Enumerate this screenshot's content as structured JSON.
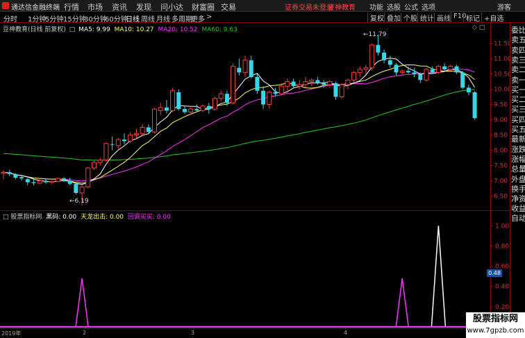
{
  "app": {
    "title": "通达信金融终端",
    "menu": [
      "行情",
      "市场",
      "资讯",
      "发现",
      "问小达",
      "财富圈",
      "交易"
    ],
    "notice": "证券交易未登录",
    "brand": "豆神教育",
    "right_menu": [
      "功能",
      "选股",
      "公式",
      "选项"
    ],
    "guest": "游客"
  },
  "toolbar": {
    "periods": [
      "分时",
      "1分钟",
      "5分钟",
      "15分钟",
      "30分钟",
      "60分钟",
      "日线",
      "周线",
      "月线",
      "多周期",
      "更多"
    ],
    "active": "日线",
    "more_arrow": ">",
    "right_items": [
      "复权",
      "叠加",
      "个股",
      "统计",
      "画线",
      "F10",
      "标记",
      "+自选"
    ]
  },
  "chart": {
    "title": "豆神教育(日线 前复权)",
    "ma5": "MA5: 9.99",
    "ma10": "MA10: 10.27",
    "ma20": "MA20: 10.52",
    "ma60": "MA60: 9.63",
    "high_label": "11.79",
    "low_label": "6.19",
    "price_ticks": [
      "11.50",
      "11.00",
      "10.50",
      "10.00",
      "9.50",
      "9.00",
      "8.50",
      "8.00",
      "7.50",
      "7.00",
      "6.50"
    ]
  },
  "indicator": {
    "name": "股票指标网",
    "l1": "黑码: 0.00",
    "l2": "天龙出击: 0.00",
    "l3": "回调买买: 0.00",
    "ticks": [
      "1.00",
      "0.80",
      "0.60",
      "0.40",
      "0.20"
    ],
    "current": "0.48"
  },
  "timeline": {
    "labels": [
      "2019年",
      "2",
      "3",
      "4"
    ]
  },
  "sidebar": {
    "items": [
      "委比",
      "卖五",
      "卖四",
      "卖三",
      "卖二",
      "卖一",
      "买一",
      "买二",
      "买三",
      "买四",
      "买五",
      "最新",
      "涨跌",
      "涨幅",
      "总量",
      "外盘",
      "换手",
      "净资",
      "收益"
    ],
    "auto": "自动"
  },
  "watermark": {
    "line1": "股票指标网",
    "line2": "www.7gpzb.com"
  },
  "colors": {
    "up": "#ff3b3b",
    "down": "#37d7e8",
    "ma5": "#ffffff",
    "ma10": "#ffff66",
    "ma20": "#ff33ff",
    "ma60": "#22cc22",
    "signal": "#ff33ff"
  },
  "chart_data": {
    "type": "candlestick",
    "candles": [
      {
        "o": 7.25,
        "h": 7.35,
        "l": 7.05,
        "c": 7.28
      },
      {
        "o": 7.28,
        "h": 7.35,
        "l": 7.15,
        "c": 7.22
      },
      {
        "o": 7.2,
        "h": 7.25,
        "l": 7.05,
        "c": 7.1
      },
      {
        "o": 7.12,
        "h": 7.2,
        "l": 7.0,
        "c": 7.08
      },
      {
        "o": 7.05,
        "h": 7.1,
        "l": 6.85,
        "c": 6.95
      },
      {
        "o": 6.95,
        "h": 7.05,
        "l": 6.85,
        "c": 6.92
      },
      {
        "o": 6.92,
        "h": 7.05,
        "l": 6.88,
        "c": 7.0
      },
      {
        "o": 7.0,
        "h": 7.05,
        "l": 6.9,
        "c": 6.95
      },
      {
        "o": 6.95,
        "h": 7.0,
        "l": 6.9,
        "c": 6.98
      },
      {
        "o": 6.98,
        "h": 7.1,
        "l": 6.95,
        "c": 7.08
      },
      {
        "o": 7.08,
        "h": 7.12,
        "l": 6.95,
        "c": 7.0
      },
      {
        "o": 7.0,
        "h": 7.1,
        "l": 6.85,
        "c": 6.9
      },
      {
        "o": 6.9,
        "h": 6.95,
        "l": 6.55,
        "c": 6.6
      },
      {
        "o": 6.6,
        "h": 6.85,
        "l": 6.19,
        "c": 6.8
      },
      {
        "o": 6.8,
        "h": 7.45,
        "l": 6.75,
        "c": 7.42
      },
      {
        "o": 7.42,
        "h": 7.65,
        "l": 7.35,
        "c": 7.6
      },
      {
        "o": 7.6,
        "h": 7.75,
        "l": 7.5,
        "c": 7.68
      },
      {
        "o": 7.68,
        "h": 8.25,
        "l": 7.62,
        "c": 8.22
      },
      {
        "o": 8.2,
        "h": 8.45,
        "l": 8.0,
        "c": 8.18
      },
      {
        "o": 8.15,
        "h": 8.4,
        "l": 8.05,
        "c": 8.35
      },
      {
        "o": 8.35,
        "h": 8.55,
        "l": 8.2,
        "c": 8.3
      },
      {
        "o": 8.3,
        "h": 8.6,
        "l": 8.25,
        "c": 8.5
      },
      {
        "o": 8.5,
        "h": 8.7,
        "l": 8.4,
        "c": 8.55
      },
      {
        "o": 8.55,
        "h": 8.85,
        "l": 8.45,
        "c": 8.75
      },
      {
        "o": 8.75,
        "h": 8.85,
        "l": 8.55,
        "c": 8.6
      },
      {
        "o": 8.6,
        "h": 9.4,
        "l": 8.55,
        "c": 9.35
      },
      {
        "o": 9.3,
        "h": 9.55,
        "l": 9.15,
        "c": 9.4
      },
      {
        "o": 9.4,
        "h": 9.65,
        "l": 9.2,
        "c": 9.3
      },
      {
        "o": 9.3,
        "h": 10.05,
        "l": 9.25,
        "c": 9.95
      },
      {
        "o": 9.9,
        "h": 10.0,
        "l": 9.3,
        "c": 9.35
      },
      {
        "o": 9.35,
        "h": 9.45,
        "l": 9.2,
        "c": 9.25
      },
      {
        "o": 9.25,
        "h": 9.4,
        "l": 9.15,
        "c": 9.35
      },
      {
        "o": 9.35,
        "h": 9.5,
        "l": 9.25,
        "c": 9.3
      },
      {
        "o": 9.3,
        "h": 9.5,
        "l": 9.25,
        "c": 9.45
      },
      {
        "o": 9.45,
        "h": 9.55,
        "l": 9.2,
        "c": 9.35
      },
      {
        "o": 9.35,
        "h": 9.75,
        "l": 9.3,
        "c": 9.7
      },
      {
        "o": 9.7,
        "h": 9.95,
        "l": 9.6,
        "c": 9.85
      },
      {
        "o": 9.85,
        "h": 9.95,
        "l": 9.45,
        "c": 9.55
      },
      {
        "o": 9.55,
        "h": 10.85,
        "l": 9.5,
        "c": 10.75
      },
      {
        "o": 10.7,
        "h": 11.0,
        "l": 10.45,
        "c": 10.55
      },
      {
        "o": 10.55,
        "h": 11.1,
        "l": 10.4,
        "c": 10.95
      },
      {
        "o": 10.95,
        "h": 11.1,
        "l": 10.35,
        "c": 10.4
      },
      {
        "o": 10.4,
        "h": 10.5,
        "l": 9.85,
        "c": 9.95
      },
      {
        "o": 9.95,
        "h": 10.1,
        "l": 9.35,
        "c": 9.5
      },
      {
        "o": 9.5,
        "h": 9.95,
        "l": 9.35,
        "c": 9.9
      },
      {
        "o": 9.9,
        "h": 10.05,
        "l": 9.75,
        "c": 9.85
      },
      {
        "o": 9.85,
        "h": 10.2,
        "l": 9.8,
        "c": 10.1
      },
      {
        "o": 10.1,
        "h": 10.35,
        "l": 9.95,
        "c": 10.25
      },
      {
        "o": 10.25,
        "h": 10.35,
        "l": 10.05,
        "c": 10.1
      },
      {
        "o": 10.1,
        "h": 10.3,
        "l": 10.0,
        "c": 10.15
      },
      {
        "o": 10.15,
        "h": 10.4,
        "l": 10.05,
        "c": 10.25
      },
      {
        "o": 10.25,
        "h": 10.35,
        "l": 10.1,
        "c": 10.3
      },
      {
        "o": 10.3,
        "h": 10.4,
        "l": 10.15,
        "c": 10.2
      },
      {
        "o": 10.2,
        "h": 10.3,
        "l": 10.05,
        "c": 10.15
      },
      {
        "o": 10.15,
        "h": 10.3,
        "l": 10.05,
        "c": 10.25
      },
      {
        "o": 10.2,
        "h": 10.25,
        "l": 9.65,
        "c": 9.75
      },
      {
        "o": 9.75,
        "h": 10.2,
        "l": 9.7,
        "c": 10.15
      },
      {
        "o": 10.15,
        "h": 10.35,
        "l": 10.0,
        "c": 10.3
      },
      {
        "o": 10.3,
        "h": 10.6,
        "l": 10.2,
        "c": 10.55
      },
      {
        "o": 10.55,
        "h": 10.75,
        "l": 10.4,
        "c": 10.65
      },
      {
        "o": 10.65,
        "h": 10.8,
        "l": 10.5,
        "c": 10.7
      },
      {
        "o": 10.7,
        "h": 11.5,
        "l": 10.6,
        "c": 11.45
      },
      {
        "o": 11.45,
        "h": 11.79,
        "l": 11.1,
        "c": 11.2
      },
      {
        "o": 11.2,
        "h": 11.3,
        "l": 10.85,
        "c": 10.95
      },
      {
        "o": 10.95,
        "h": 11.1,
        "l": 10.7,
        "c": 10.8
      },
      {
        "o": 10.8,
        "h": 10.85,
        "l": 10.45,
        "c": 10.55
      },
      {
        "o": 10.55,
        "h": 10.65,
        "l": 10.45,
        "c": 10.6
      },
      {
        "o": 10.6,
        "h": 10.75,
        "l": 10.5,
        "c": 10.55
      },
      {
        "o": 10.55,
        "h": 10.7,
        "l": 10.4,
        "c": 10.5
      },
      {
        "o": 10.5,
        "h": 10.55,
        "l": 10.2,
        "c": 10.3
      },
      {
        "o": 10.3,
        "h": 10.7,
        "l": 10.25,
        "c": 10.65
      },
      {
        "o": 10.65,
        "h": 10.75,
        "l": 10.5,
        "c": 10.55
      },
      {
        "o": 10.55,
        "h": 10.8,
        "l": 10.5,
        "c": 10.75
      },
      {
        "o": 10.75,
        "h": 10.85,
        "l": 10.6,
        "c": 10.65
      },
      {
        "o": 10.65,
        "h": 10.8,
        "l": 10.6,
        "c": 10.75
      },
      {
        "o": 10.75,
        "h": 10.8,
        "l": 10.5,
        "c": 10.55
      },
      {
        "o": 10.55,
        "h": 10.6,
        "l": 10.0,
        "c": 10.05
      },
      {
        "o": 10.05,
        "h": 10.15,
        "l": 9.8,
        "c": 9.9
      },
      {
        "o": 9.9,
        "h": 9.95,
        "l": 9.0,
        "c": 9.05
      }
    ],
    "indicator_spikes": [
      {
        "index": 13,
        "value": 0.48,
        "series": "天龙出击"
      },
      {
        "index": 66,
        "value": 0.48,
        "series": "天龙出击"
      },
      {
        "index": 72,
        "value": 1.0,
        "series": "回调买买"
      }
    ],
    "price_range": [
      6.1,
      11.9
    ],
    "indicator_range": [
      0,
      1.05
    ]
  }
}
